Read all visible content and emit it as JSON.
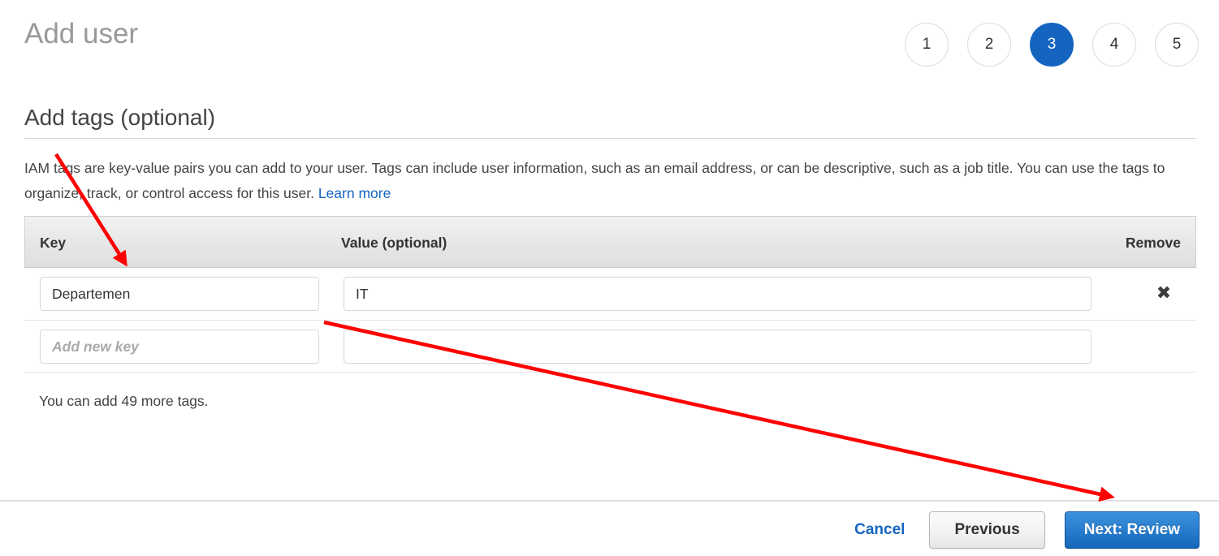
{
  "header": {
    "title": "Add user",
    "steps": [
      {
        "label": "1",
        "active": false
      },
      {
        "label": "2",
        "active": false
      },
      {
        "label": "3",
        "active": true
      },
      {
        "label": "4",
        "active": false
      },
      {
        "label": "5",
        "active": false
      }
    ]
  },
  "section": {
    "title": "Add tags (optional)",
    "description_part1": "IAM tags are key-value pairs you can add to your user. Tags can include user information, such as an email address, or can be descriptive, such as a job title. You can use the tags to organize, track, or control access for this user. ",
    "learn_more_label": "Learn more"
  },
  "tags_table": {
    "columns": {
      "key": "Key",
      "value": "Value (optional)",
      "remove": "Remove"
    },
    "rows": [
      {
        "key_value": "Departemen",
        "key_placeholder": "",
        "value_value": "IT",
        "value_placeholder": "",
        "remove_icon": "✖",
        "has_remove": true
      },
      {
        "key_value": "",
        "key_placeholder": "Add new key",
        "value_value": "",
        "value_placeholder": "",
        "remove_icon": "",
        "has_remove": false
      }
    ],
    "remaining_text": "You can add 49 more tags."
  },
  "footer": {
    "cancel_label": "Cancel",
    "previous_label": "Previous",
    "next_label": "Next: Review"
  },
  "colors": {
    "accent_blue": "#1565c0",
    "button_blue": "#2a7fd0",
    "annotation_red": "#ff0000",
    "header_gray": "#e6e6e6",
    "title_gray": "#999999"
  },
  "annotations": {
    "arrow_1_name": "arrow-to-key-column",
    "arrow_2_name": "arrow-to-next-review-button"
  }
}
